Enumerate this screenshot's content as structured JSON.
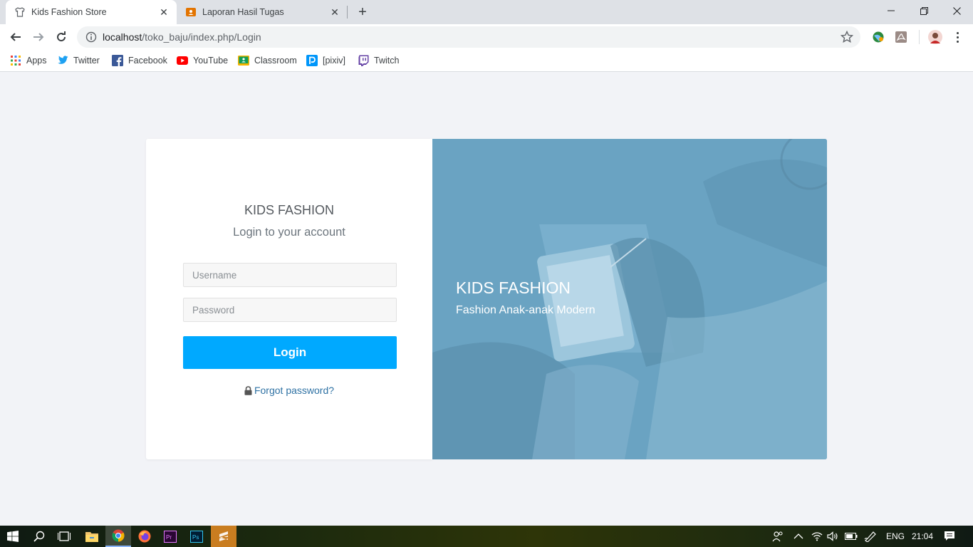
{
  "browser": {
    "tabs": [
      {
        "title": "Kids Fashion Store",
        "active": true
      },
      {
        "title": "Laporan Hasil Tugas",
        "active": false
      }
    ],
    "url": {
      "host": "localhost",
      "path": "/toko_baju/index.php/Login"
    },
    "bookmarks": [
      "Apps",
      "Twitter",
      "Facebook",
      "YouTube",
      "Classroom",
      "[pixiv]",
      "Twitch"
    ]
  },
  "login": {
    "brand": "KIDS FASHION",
    "subtitle": "Login to your account",
    "username_placeholder": "Username",
    "password_placeholder": "Password",
    "button_label": "Login",
    "forgot_label": "Forgot password?"
  },
  "hero": {
    "title": "KIDS FASHION",
    "subtitle": "Fashion Anak-anak Modern"
  },
  "taskbar": {
    "language": "ENG",
    "time": "21:04"
  },
  "colors": {
    "accent": "#00a9ff",
    "hero_bg": "#6aa3c2",
    "page_bg": "#f2f3f7",
    "link": "#2f72a4"
  }
}
